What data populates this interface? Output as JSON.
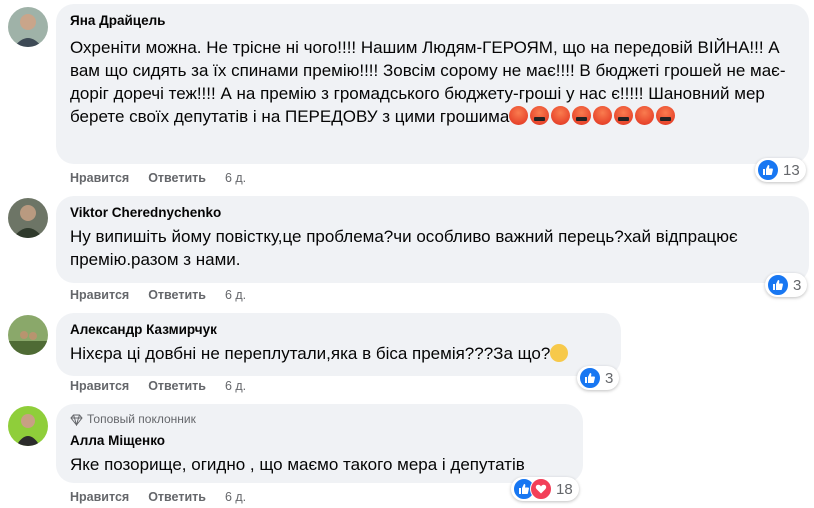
{
  "actions": {
    "like": "Нравится",
    "reply": "Ответить"
  },
  "comments": [
    {
      "author": "Яна Драйцель",
      "text": "Охреніти можна. Не трісне ні чого!!!! Нашим Людям-ГЕРОЯМ, що на передовій ВІЙНА!!! А вам що сидять за їх спинами премію!!!! Зовсім сорому не має!!!! В бюджеті грошей не має-доріг доречі теж!!!! А на премію з громадського бюджету-гроші у нас є!!!!! Шановний мер берете своїх депутатів і на ПЕРЕДОВУ з цими грошима",
      "time": "6 д.",
      "reaction_count": "13",
      "emojis": [
        "angry-face-icon",
        "cursing-face-icon",
        "angry-face-icon",
        "cursing-face-icon",
        "angry-face-icon",
        "cursing-face-icon",
        "angry-face-icon",
        "cursing-face-icon"
      ]
    },
    {
      "author": "Viktor Cherednychenko",
      "text": "Ну випишіть йому повістку,це проблема?чи особливо важний перець?хай відпрацює премію.разом з нами.",
      "time": "6 д.",
      "reaction_count": "3"
    },
    {
      "author": "Александр Казмирчук",
      "text": "Ніхєра ці довбні не переплутали,яка в біса премія???За що?",
      "time": "6 д.",
      "reaction_count": "3"
    },
    {
      "badge": "Топовый поклонник",
      "author": "Алла Міщенко",
      "text": "Яке позорище, огидно , що маємо такого мера і депутатів",
      "time": "6 д.",
      "reaction_count": "18"
    }
  ],
  "colors": {
    "like": "#1877f2",
    "love": "#f33e58",
    "bubble": "#f0f2f5",
    "meta": "#65676b"
  }
}
